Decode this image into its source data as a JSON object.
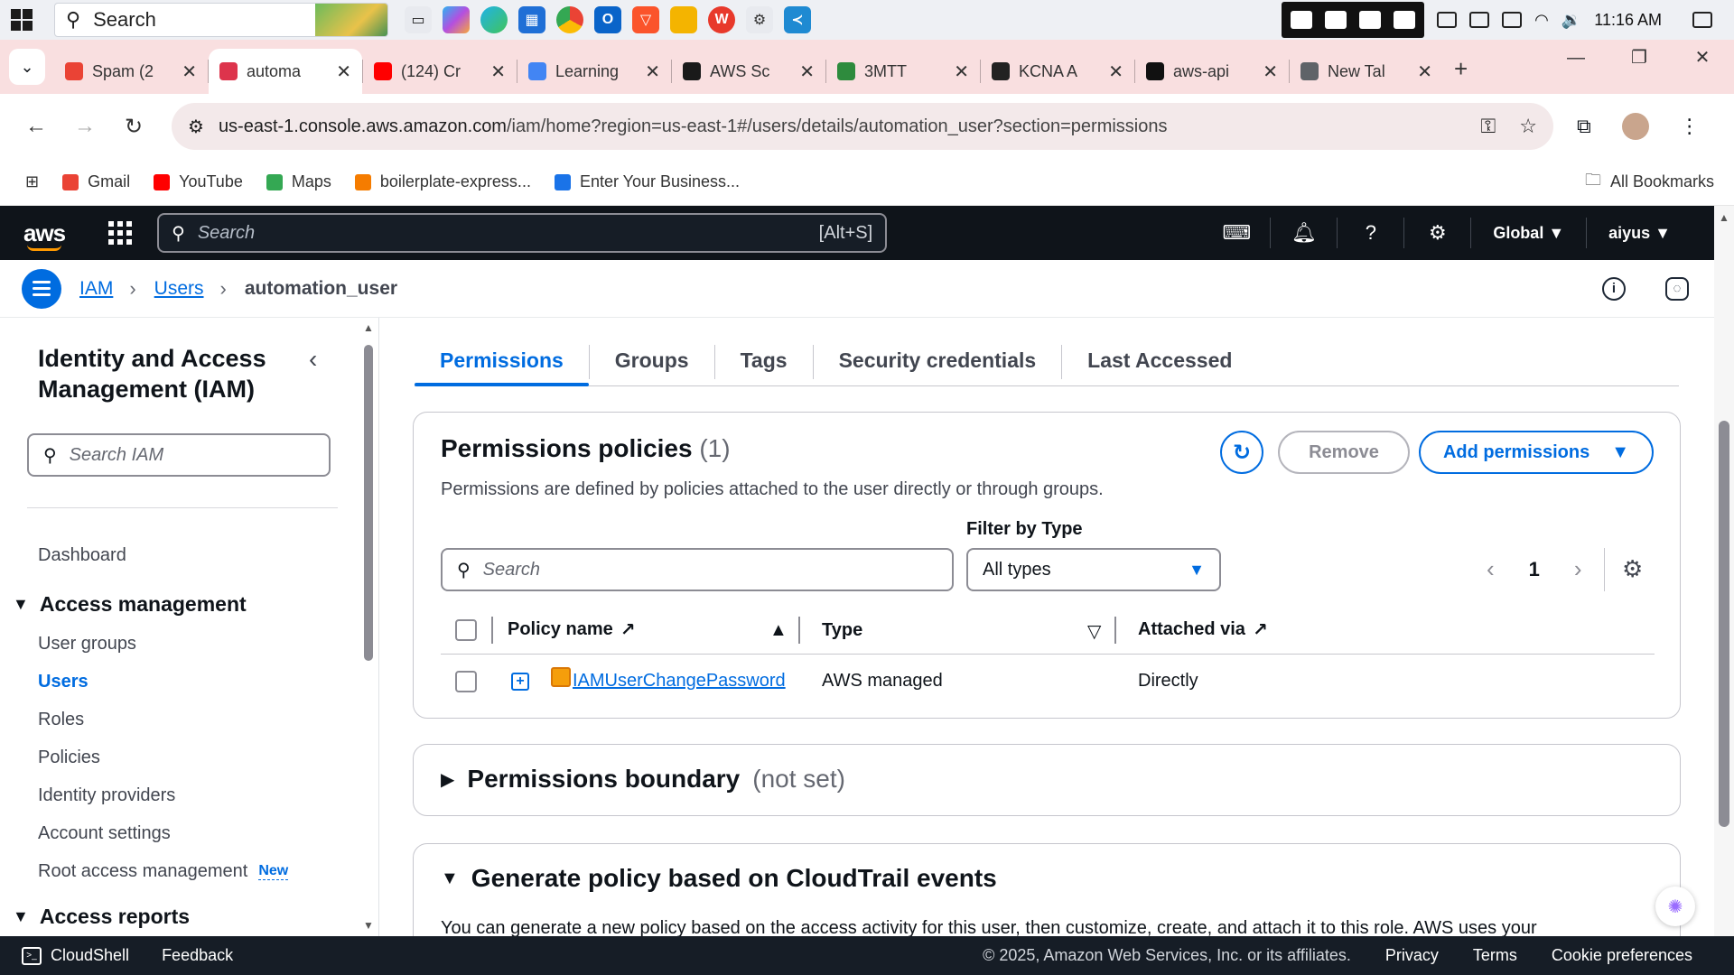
{
  "taskbar": {
    "search_label": "Search",
    "clock": "11:16 AM"
  },
  "browser": {
    "tabs": [
      {
        "title": "Spam (2",
        "color": "#ea4335"
      },
      {
        "title": "automa",
        "color": "#dd344c",
        "active": true
      },
      {
        "title": "(124) Cr",
        "color": "#ff0000"
      },
      {
        "title": "Learning",
        "color": "#4285f4"
      },
      {
        "title": "AWS Sc",
        "color": "#1a1a1a"
      },
      {
        "title": "3MTT",
        "color": "#2e8b3d"
      },
      {
        "title": "KCNA A",
        "color": "#222222"
      },
      {
        "title": "aws-api",
        "color": "#111111"
      },
      {
        "title": "New Tal",
        "color": "#5f6368"
      }
    ],
    "url_host": "us-east-1.console.aws.amazon.com",
    "url_path": "/iam/home?region=us-east-1#/users/details/automation_user?section=permissions",
    "bookmarks": [
      {
        "label": "Gmail",
        "color": "#ea4335"
      },
      {
        "label": "YouTube",
        "color": "#ff0000"
      },
      {
        "label": "Maps",
        "color": "#34a853"
      },
      {
        "label": "boilerplate-express...",
        "color": "#f57c00"
      },
      {
        "label": "Enter Your Business...",
        "color": "#1a73e8"
      }
    ],
    "all_bookmarks": "All Bookmarks"
  },
  "aws_header": {
    "logo": "aws",
    "search_placeholder": "Search",
    "shortcut": "[Alt+S]",
    "region": "Global ▼",
    "user": "aiyus ▼"
  },
  "breadcrumb": {
    "items": [
      "IAM",
      "Users"
    ],
    "current": "automation_user",
    "sep": "›"
  },
  "sidebar": {
    "title": "Identity and Access Management (IAM)",
    "search_placeholder": "Search IAM",
    "dashboard": "Dashboard",
    "section_access_mgmt": "Access management",
    "items": [
      "User groups",
      "Users",
      "Roles",
      "Policies",
      "Identity providers",
      "Account settings",
      "Root access management"
    ],
    "new_badge": "New",
    "section_access_reports": "Access reports"
  },
  "tabs": [
    "Permissions",
    "Groups",
    "Tags",
    "Security credentials",
    "Last Accessed"
  ],
  "permissions_policies": {
    "title": "Permissions policies",
    "count": "(1)",
    "description": "Permissions are defined by policies attached to the user directly or through groups.",
    "remove_label": "Remove",
    "add_label": "Add permissions",
    "filter_label": "Filter by Type",
    "search_placeholder": "Search",
    "type_value": "All types",
    "page": "1",
    "columns": [
      "Policy name",
      "Type",
      "Attached via"
    ],
    "rows": [
      {
        "name": "IAMUserChangePassword",
        "type": "AWS managed",
        "attached_via": "Directly"
      }
    ]
  },
  "permissions_boundary": {
    "title": "Permissions boundary",
    "status": "(not set)"
  },
  "generate_policy": {
    "title": "Generate policy based on CloudTrail events",
    "description": "You can generate a new policy based on the access activity for this user, then customize, create, and attach it to this role. AWS uses your"
  },
  "footer": {
    "cloudshell": "CloudShell",
    "feedback": "Feedback",
    "copyright": "© 2025, Amazon Web Services, Inc. or its affiliates.",
    "privacy": "Privacy",
    "terms": "Terms",
    "cookie": "Cookie preferences"
  },
  "colors": {
    "aws_header": "#0f141a",
    "link_blue": "#006ce0",
    "tabstrip": "#f9dfe0"
  }
}
